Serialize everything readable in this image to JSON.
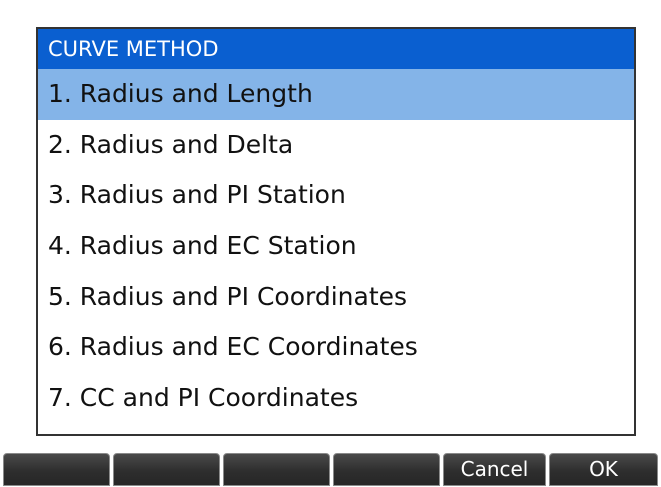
{
  "dialog": {
    "title": "CURVE METHOD",
    "selected_index": 0,
    "items": [
      {
        "label": "1. Radius and Length"
      },
      {
        "label": "2. Radius and Delta"
      },
      {
        "label": "3. Radius and PI Station"
      },
      {
        "label": "4. Radius and EC Station"
      },
      {
        "label": "5. Radius and PI Coordinates"
      },
      {
        "label": "6. Radius and EC Coordinates"
      },
      {
        "label": "7. CC and PI Coordinates"
      }
    ]
  },
  "softkeys": [
    "",
    "",
    "",
    "",
    "Cancel",
    "OK"
  ],
  "colors": {
    "title_bar": "#0a5fd0",
    "selected_row": "#84b4e8",
    "softkey_bg": "#2e2e2e"
  }
}
